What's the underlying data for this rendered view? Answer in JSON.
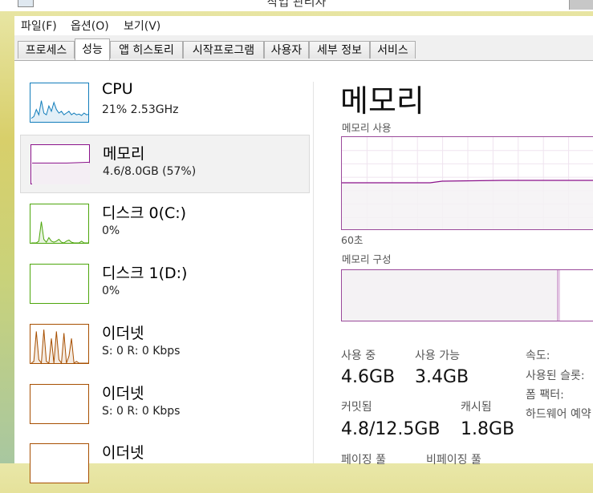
{
  "window": {
    "title": "작업 관리자"
  },
  "menu": [
    {
      "label": "파일(F)"
    },
    {
      "label": "옵션(O)"
    },
    {
      "label": "보기(V)"
    }
  ],
  "tabs": [
    {
      "label": "프로세스"
    },
    {
      "label": "성능"
    },
    {
      "label": "앱 히스토리"
    },
    {
      "label": "시작프로그램"
    },
    {
      "label": "사용자"
    },
    {
      "label": "세부 정보"
    },
    {
      "label": "서비스"
    }
  ],
  "active_tab": "성능",
  "sidebar": {
    "items": [
      {
        "title": "CPU",
        "subtitle": "21%  2.53GHz",
        "color": "#117dbb",
        "graph": "cpu",
        "levels": [
          0.1,
          0.15,
          0.35,
          0.2,
          0.6,
          0.25,
          0.2,
          0.45,
          0.3,
          0.55,
          0.35,
          0.25,
          0.3,
          0.2,
          0.25,
          0.3,
          0.2,
          0.25,
          0.2,
          0.22,
          0.18,
          0.25,
          0.2,
          0.22
        ]
      },
      {
        "title": "메모리",
        "subtitle": "4.6/8.0GB (57%)",
        "color": "#8b128b",
        "graph": "memory",
        "level": 0.57
      },
      {
        "title": "디스크 0(C:)",
        "subtitle": "0%",
        "color": "#4da60c",
        "graph": "disk",
        "levels": [
          0,
          0,
          0,
          0.05,
          0.6,
          0.1,
          0.02,
          0.15,
          0.05,
          0.02,
          0.05,
          0.1,
          0.02,
          0,
          0.05,
          0.08,
          0.02,
          0,
          0,
          0,
          0.05,
          0,
          0,
          0
        ]
      },
      {
        "title": "디스크 1(D:)",
        "subtitle": "0%",
        "color": "#4da60c",
        "graph": "disk",
        "levels": []
      },
      {
        "title": "이더넷",
        "subtitle": "S: 0  R: 0 Kbps",
        "color": "#a74f01",
        "graph": "ethernet",
        "levels": [
          0,
          0.05,
          0.9,
          0.1,
          0,
          0.95,
          0.05,
          0,
          0.7,
          0,
          0.9,
          0.1,
          0,
          0.85,
          0,
          0.2,
          0.7,
          0,
          0.05,
          0,
          0,
          0,
          0,
          0
        ]
      },
      {
        "title": "이더넷",
        "subtitle": "S: 0  R: 0 Kbps",
        "color": "#a74f01",
        "graph": "ethernet",
        "levels": []
      },
      {
        "title": "이더넷",
        "subtitle": "",
        "color": "#a74f01",
        "graph": "ethernet",
        "levels": []
      }
    ]
  },
  "detail": {
    "title": "메모리",
    "usage_label": "메모리 사용",
    "time_label": "60초",
    "composition_label": "메모리 구성",
    "in_use_fraction": 0.57,
    "stats": {
      "in_use": {
        "label": "사용 중",
        "value": "4.6GB"
      },
      "available": {
        "label": "사용 가능",
        "value": "3.4GB"
      },
      "committed": {
        "label": "커밋됨",
        "value": "4.8/12.5GB"
      },
      "cached": {
        "label": "캐시됨",
        "value": "1.8GB"
      },
      "paged_pool": {
        "label": "페이징 풀"
      },
      "nonpaged_pool": {
        "label": "비페이징 풀"
      }
    },
    "specs": {
      "speed": "속도:",
      "slots_used": "사용된 슬롯:",
      "form_factor": "폼 팩터:",
      "hardware_reserved": "하드웨어 예약"
    }
  },
  "colors": {
    "memory": "#8b128b",
    "memory_fill": "#f4f2f4",
    "grid": "#efe4ef"
  }
}
